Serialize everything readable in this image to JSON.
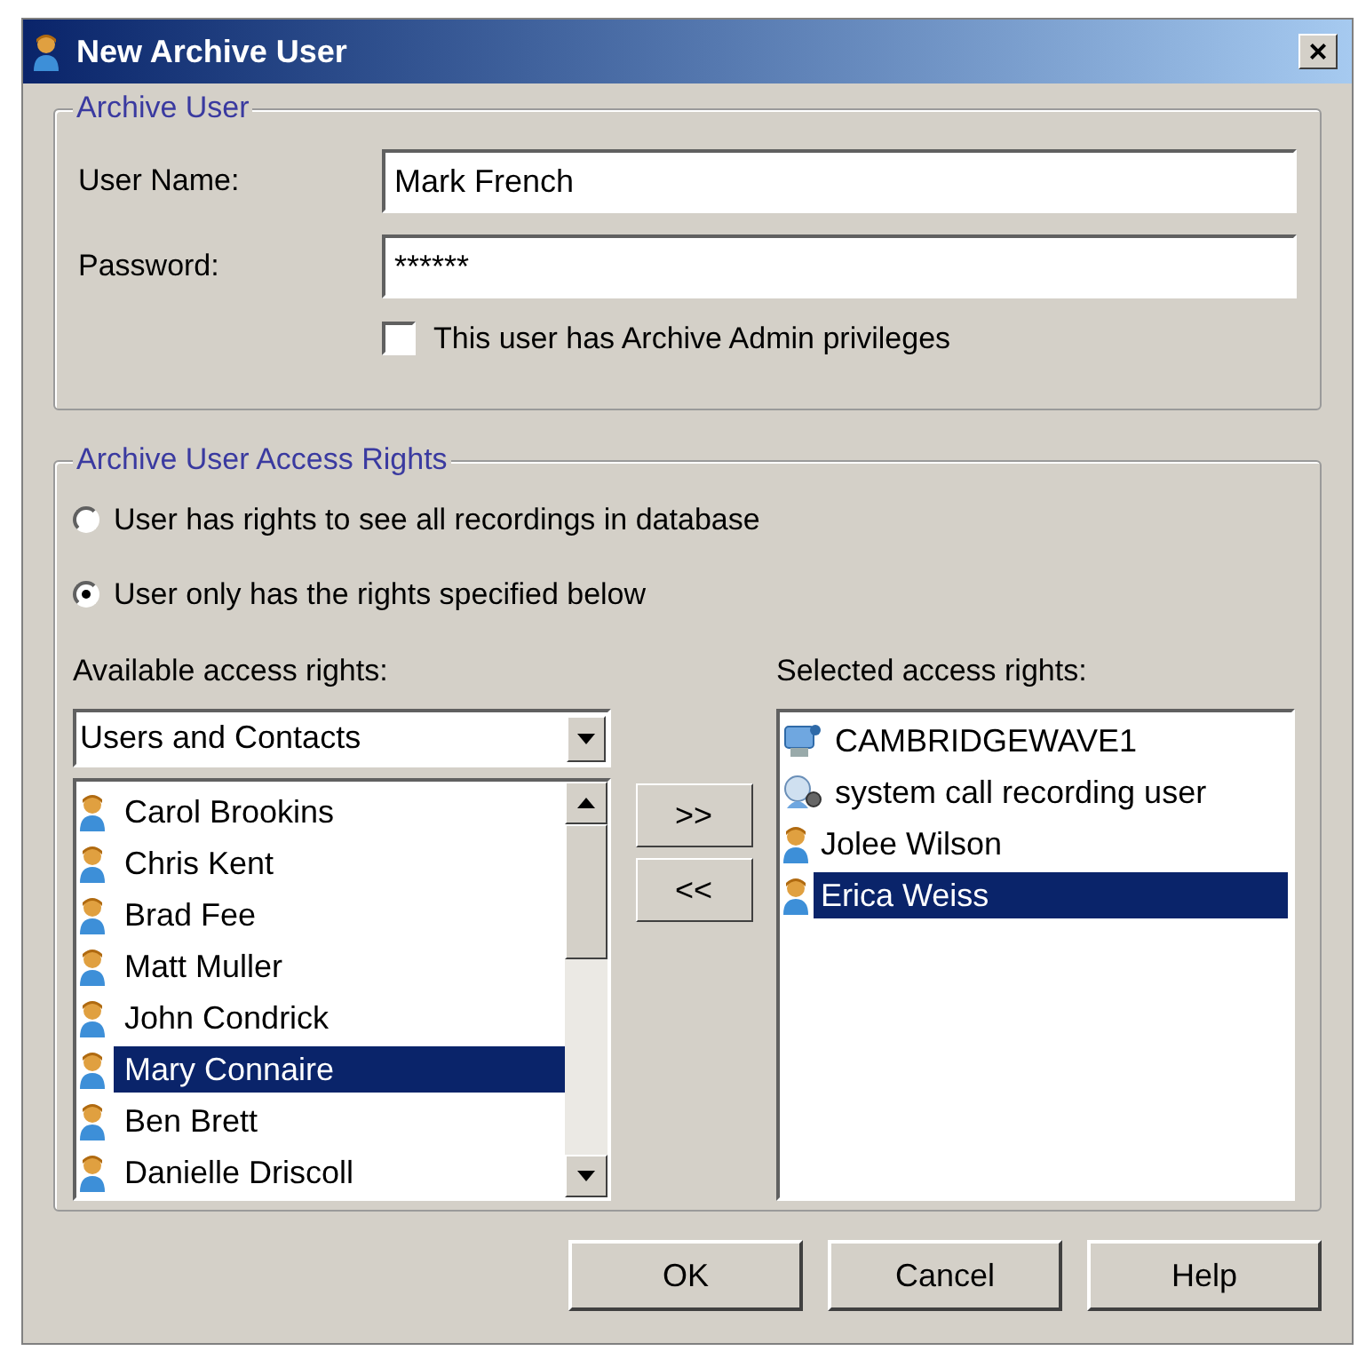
{
  "window": {
    "title": "New Archive User",
    "close": "×"
  },
  "archive_user": {
    "legend": "Archive User",
    "user_name_label": "User Name:",
    "user_name": "Mark French",
    "password_label": "Password:",
    "password": "******",
    "admin": {
      "label": "This user has Archive Admin privileges",
      "checked": false
    }
  },
  "access_rights": {
    "legend": "Archive User Access Rights",
    "options": [
      {
        "label": "User has rights to see all recordings in database",
        "selected": false
      },
      {
        "label": "User only has the rights specified below",
        "selected": true
      }
    ],
    "available_label": "Available access rights:",
    "category": "Users and Contacts",
    "available": [
      {
        "name": "Carol Brookins",
        "selected": false
      },
      {
        "name": "Chris Kent",
        "selected": false
      },
      {
        "name": "Brad Fee",
        "selected": false
      },
      {
        "name": "Matt Muller",
        "selected": false
      },
      {
        "name": "John Condrick",
        "selected": false
      },
      {
        "name": "Mary Connaire",
        "selected": true
      },
      {
        "name": "Ben Brett",
        "selected": false
      },
      {
        "name": "Danielle Driscoll",
        "selected": false
      }
    ],
    "add_button": ">>",
    "remove_button": "<<",
    "selected_label": "Selected access rights:",
    "selected_rights": [
      {
        "name": "CAMBRIDGEWAVE1",
        "kind": "computer",
        "selected": false
      },
      {
        "name": "system call recording user",
        "kind": "system",
        "selected": false
      },
      {
        "name": "Jolee Wilson",
        "kind": "person",
        "selected": false
      },
      {
        "name": "Erica Weiss",
        "kind": "person",
        "selected": true
      }
    ]
  },
  "buttons": [
    "OK",
    "Cancel",
    "Help"
  ]
}
